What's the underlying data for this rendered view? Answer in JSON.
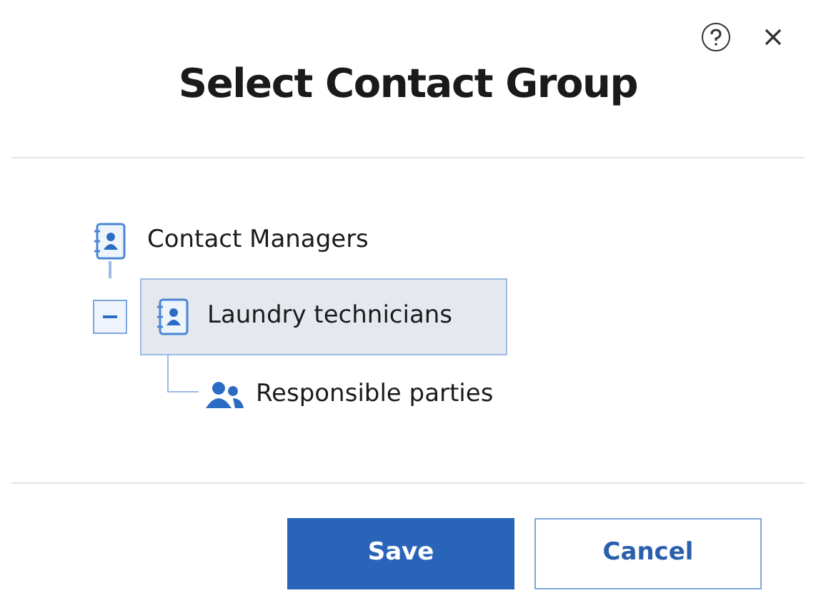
{
  "dialog": {
    "title": "Select Contact Group"
  },
  "tree": [
    {
      "label": "Contact Managers",
      "kind": "book",
      "selected": false,
      "children": [
        {
          "label": "Laundry technicians",
          "kind": "book",
          "selected": true,
          "expanded": true,
          "children": [
            {
              "label": "Responsible parties",
              "kind": "people",
              "selected": false
            }
          ]
        }
      ]
    }
  ],
  "buttons": [
    {
      "label": "Save",
      "kind": "primary"
    },
    {
      "label": "Cancel",
      "kind": "secondary"
    }
  ]
}
